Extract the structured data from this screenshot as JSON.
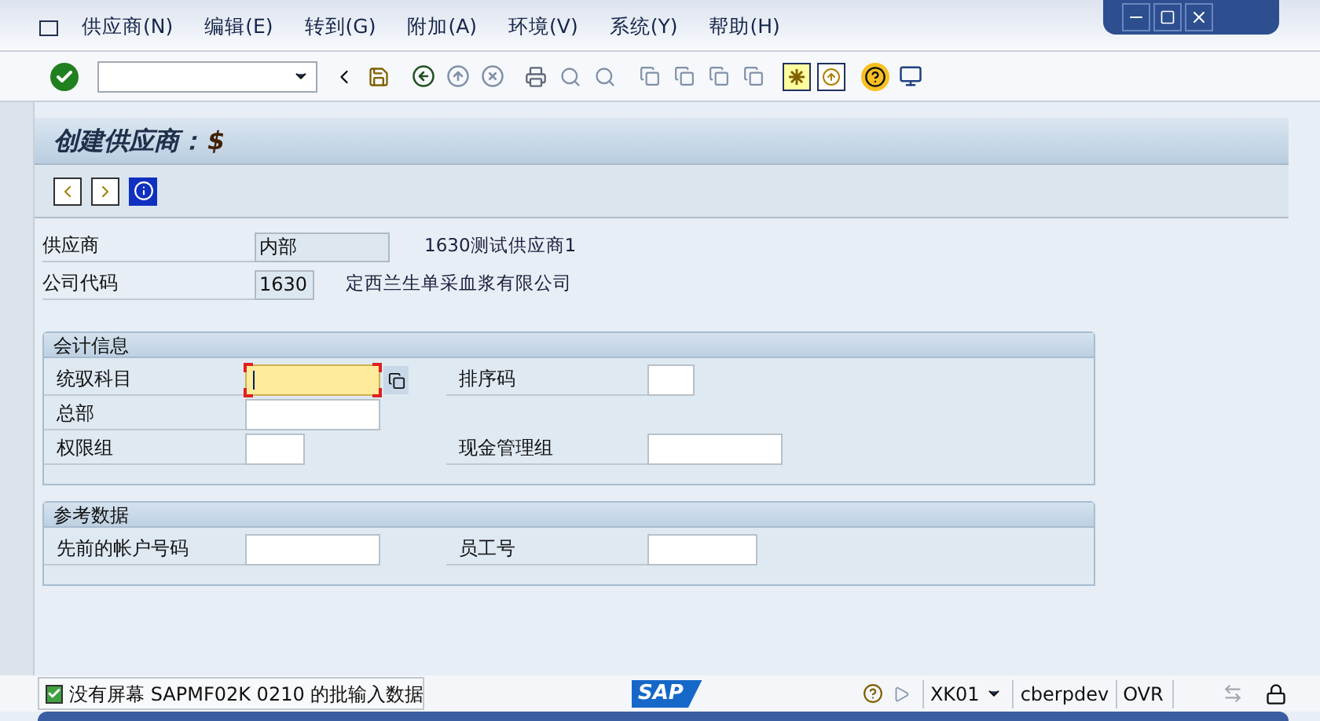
{
  "menu": [
    "供应商(N)",
    "编辑(E)",
    "转到(G)",
    "附加(A)",
    "环境(V)",
    "系统(Y)",
    "帮助(H)"
  ],
  "title": {
    "text": "创建供应商：",
    "symbol": "$"
  },
  "header_fields": [
    {
      "label": "供应商",
      "value": "内部",
      "description": "1630测试供应商1"
    },
    {
      "label": "公司代码",
      "value": "1630",
      "description": "定西兰生单采血浆有限公司"
    }
  ],
  "groups": [
    {
      "title": "会计信息",
      "rows": [
        [
          {
            "label": "统驭科目",
            "focused": true,
            "required": true
          },
          {
            "label": "排序码",
            "focused": false,
            "required": false
          }
        ],
        [
          {
            "label": "总部",
            "focused": false,
            "required": false
          }
        ],
        [
          {
            "label": "权限组",
            "focused": false,
            "required": false
          },
          {
            "label": "现金管理组",
            "focused": false,
            "required": false
          }
        ]
      ]
    },
    {
      "title": "参考数据",
      "rows": [
        [
          {
            "label": "先前的帐户号码",
            "focused": false,
            "required": false
          },
          {
            "label": "员工号",
            "focused": false,
            "required": false
          }
        ]
      ]
    }
  ],
  "status_bar": {
    "message": {
      "kind": "success",
      "text": "没有屏幕 SAPMF02K 0210 的批输入数据"
    },
    "logo": "SAP",
    "transaction": "XK01",
    "system": "cberpdev",
    "mode": "OVR"
  }
}
